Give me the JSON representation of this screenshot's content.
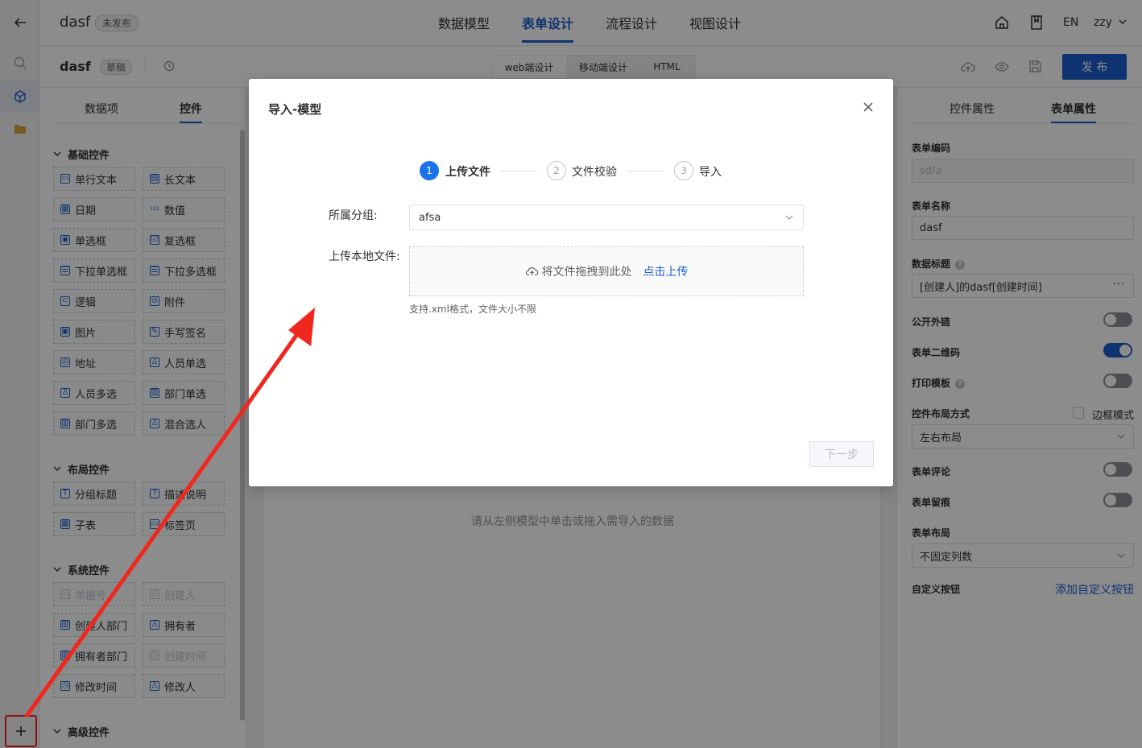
{
  "header": {
    "app_name": "dasf",
    "status_badge": "未发布",
    "tabs": [
      {
        "label": "数据模型",
        "active": false
      },
      {
        "label": "表单设计",
        "active": true
      },
      {
        "label": "流程设计",
        "active": false
      },
      {
        "label": "视图设计",
        "active": false
      }
    ],
    "lang": "EN",
    "user": "zzy"
  },
  "subheader": {
    "form_name": "dasf",
    "draft_badge": "草稿",
    "design_tabs": [
      "web端设计",
      "移动端设计",
      "HTML"
    ],
    "publish_label": "发 布"
  },
  "left_panel": {
    "tabs": [
      {
        "label": "数据项",
        "active": false
      },
      {
        "label": "控件",
        "active": true
      }
    ],
    "sections": [
      {
        "title": "基础控件",
        "controls": [
          {
            "label": "单行文本",
            "icon": "▭",
            "disabled": false
          },
          {
            "label": "长文本",
            "icon": "▤",
            "disabled": false
          },
          {
            "label": "日期",
            "icon": "▦",
            "disabled": false
          },
          {
            "label": "数值",
            "icon": "123",
            "disabled": false
          },
          {
            "label": "单选框",
            "icon": "◉",
            "disabled": false
          },
          {
            "label": "复选框",
            "icon": "☑",
            "disabled": false
          },
          {
            "label": "下拉单选框",
            "icon": "☰",
            "disabled": false
          },
          {
            "label": "下拉多选框",
            "icon": "☰",
            "disabled": false
          },
          {
            "label": "逻辑",
            "icon": "⊂",
            "disabled": false
          },
          {
            "label": "附件",
            "icon": "⊘",
            "disabled": false
          },
          {
            "label": "图片",
            "icon": "▣",
            "disabled": false
          },
          {
            "label": "手写签名",
            "icon": "✎",
            "disabled": false
          },
          {
            "label": "地址",
            "icon": "◎",
            "disabled": false
          },
          {
            "label": "人员单选",
            "icon": "♙",
            "disabled": false
          },
          {
            "label": "人员多选",
            "icon": "♙",
            "disabled": false
          },
          {
            "label": "部门单选",
            "icon": "▥",
            "disabled": false
          },
          {
            "label": "部门多选",
            "icon": "▥",
            "disabled": false
          },
          {
            "label": "混合选人",
            "icon": "♙",
            "disabled": false
          }
        ]
      },
      {
        "title": "布局控件",
        "controls": [
          {
            "label": "分组标题",
            "icon": "T",
            "disabled": false
          },
          {
            "label": "描述说明",
            "icon": "?",
            "disabled": false
          },
          {
            "label": "子表",
            "icon": "▦",
            "disabled": false
          },
          {
            "label": "标签页",
            "icon": "▭",
            "disabled": false
          }
        ]
      },
      {
        "title": "系统控件",
        "controls": [
          {
            "label": "单据号",
            "icon": "▭",
            "disabled": true
          },
          {
            "label": "创建人",
            "icon": "♙",
            "disabled": true
          },
          {
            "label": "创建人部门",
            "icon": "▥",
            "disabled": false
          },
          {
            "label": "拥有者",
            "icon": "♙",
            "disabled": false
          },
          {
            "label": "拥有者部门",
            "icon": "▥",
            "disabled": false
          },
          {
            "label": "创建时间",
            "icon": "◷",
            "disabled": true
          },
          {
            "label": "修改时间",
            "icon": "◷",
            "disabled": false
          },
          {
            "label": "修改人",
            "icon": "♙",
            "disabled": false
          }
        ]
      },
      {
        "title": "高级控件",
        "controls": []
      }
    ]
  },
  "canvas": {
    "empty_hint": "请从左侧模型中单击或拖入需导入的数据"
  },
  "right_panel": {
    "tabs": [
      {
        "label": "控件属性",
        "active": false
      },
      {
        "label": "表单属性",
        "active": true
      }
    ],
    "form_code_label": "表单编码",
    "form_code_value": "sdfa",
    "form_name_label": "表单名称",
    "form_name_value": "dasf",
    "data_title_label": "数据标题",
    "data_title_value": "[创建人]的dasf[创建时间]",
    "public_link_label": "公开外链",
    "public_link_on": false,
    "qrcode_label": "表单二维码",
    "qrcode_on": true,
    "print_label": "打印模板",
    "print_on": false,
    "layout_mode_label": "控件布局方式",
    "border_mode_label": "边框模式",
    "layout_mode_value": "左右布局",
    "comment_label": "表单评论",
    "comment_on": false,
    "trace_label": "表单留痕",
    "trace_on": false,
    "form_layout_label": "表单布局",
    "form_layout_value": "不固定列数",
    "custom_button_label": "自定义按钮",
    "add_custom_button": "添加自定义按钮"
  },
  "modal": {
    "title": "导入-模型",
    "steps": [
      {
        "num": "1",
        "label": "上传文件",
        "active": true
      },
      {
        "num": "2",
        "label": "文件校验",
        "active": false
      },
      {
        "num": "3",
        "label": "导入",
        "active": false
      }
    ],
    "group_label": "所属分组:",
    "group_value": "afsa",
    "upload_label": "上传本地文件:",
    "drop_text": "将文件拖拽到此处",
    "click_upload": "点击上传",
    "hint": "支持.xml格式，文件大小不限",
    "next_label": "下一步"
  },
  "colors": {
    "accent": "#1a5ecd",
    "arrow": "#f0271f"
  }
}
